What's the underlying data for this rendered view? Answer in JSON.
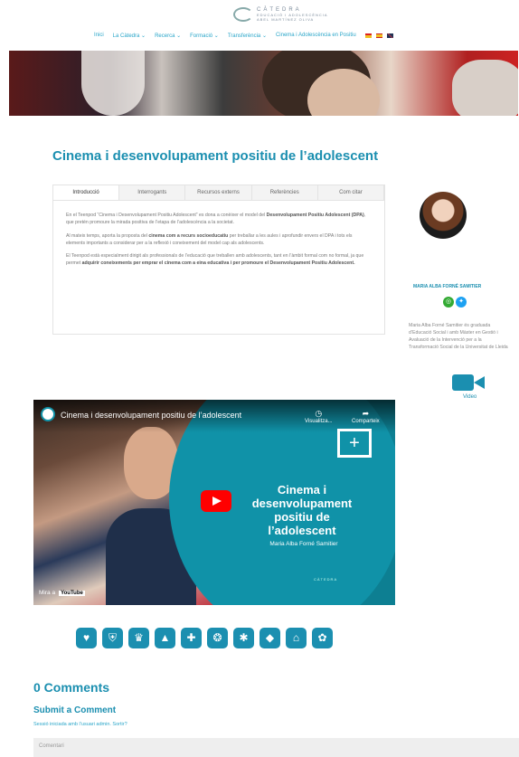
{
  "header": {
    "logo": {
      "line1": "CÀTEDRA",
      "line2": "EDUCACIÓ I ADOLESCÈNCIA",
      "line3": "ABEL MARTÍNEZ OLIVA"
    },
    "nav": [
      "Inici",
      "La Càtedra ⌄",
      "Recerca ⌄",
      "Formació ⌄",
      "Transferència ⌄",
      "Cinema i Adolescència en Positiu"
    ],
    "flags": [
      {
        "name": "catalan-flag",
        "color": "#f0c020"
      },
      {
        "name": "spanish-flag",
        "color": "#d8a020"
      },
      {
        "name": "uk-flag",
        "color": "#c46"
      }
    ]
  },
  "page": {
    "title": "Cinema i desenvolupament positiu de l’adolescent"
  },
  "tabs": {
    "items": [
      "Introducció",
      "Interrogants",
      "Recursos externs",
      "Referències",
      "Com citar"
    ],
    "active": "Introducció",
    "p1a": "En el Teenpod “Cinema i Desenvolupament Positiu Adolescent” es dona a conèixer el model del ",
    "p1b": "Desenvolupament Positiu Adolescent (DPA)",
    "p1c": ", que pretén promoure la mirada positiva de l’etapa de l’adolescència a la societat.",
    "p2a": "Al mateix temps, aporta la proposta del ",
    "p2b": "cinema com a recurs socioeducatiu",
    "p2c": " per treballar a les aules i aprofundir envers el DPA i tots els elements importants a considerar per a la reflexió i coneixement del model cap als adolescents.",
    "p3a": "El Teenpod està especialment dirigit als professionals de l’educació que treballen amb adolescents, tant en l’àmbit formal com no formal, ja que permet ",
    "p3b": "adquirir coneixements per emprar el cinema com a eina educativa i per promoure el Desenvolupament Positiu Adolescent."
  },
  "sidebar": {
    "author": "MARIA ALBA FORNÉ SAMITIER",
    "bio": "Maria Alba Forné Samitier és graduada d’Educació Social i amb Màster en Gestió i Avaluació de la Intervenció per a la Transformació Social de la Universitat de Lleida",
    "video_label": "Video"
  },
  "video": {
    "title": "Cinema i desenvolupament positiu de l’adolescent",
    "watch_later": "Visualitza...",
    "share": "Comparteix",
    "big_title_1": "Cinema i",
    "big_title_2": "desenvolupament",
    "big_title_3": "positiu de",
    "big_title_4": "l’adolescent",
    "author": "Maria Alba Forné Samitier",
    "watch_on": "Mira a",
    "youtube": "YouTube"
  },
  "icons": [
    "handshake-icon",
    "shield-icon",
    "trophy-icon",
    "group-icon",
    "medical-icon",
    "brain-icon",
    "gear-icon",
    "lock-icon",
    "home-icon",
    "globe-icon"
  ],
  "comments": {
    "count_label": "0 Comments",
    "submit_label": "Submit a Comment",
    "session": "Sessió iniciada amb l’usuari admin. Sortir?",
    "placeholder": "Comentari"
  }
}
